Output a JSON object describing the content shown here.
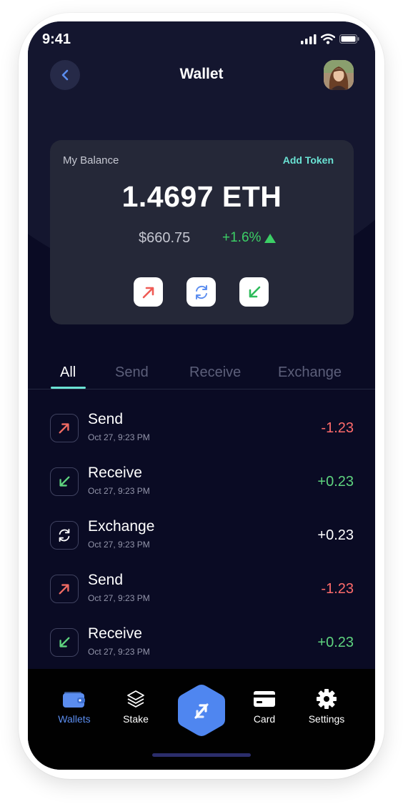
{
  "status_bar": {
    "time": "9:41"
  },
  "header": {
    "title": "Wallet"
  },
  "balance_card": {
    "label": "My Balance",
    "add_token": "Add Token",
    "amount": "1.4697 ETH",
    "usd": "$660.75",
    "change": "+1.6%"
  },
  "tabs": [
    "All",
    "Send",
    "Receive",
    "Exchange"
  ],
  "transactions": [
    {
      "name": "Send",
      "date": "Oct 27,  9:23 PM",
      "amount": "-1.23",
      "icon": "send-icon"
    },
    {
      "name": "Receive",
      "date": "Oct 27,  9:23 PM",
      "amount": "+0.23",
      "icon": "receive-icon"
    },
    {
      "name": "Exchange",
      "date": "Oct 27,  9:23 PM",
      "amount": "+0.23",
      "icon": "exchange-icon"
    },
    {
      "name": "Send",
      "date": "Oct 27,  9:23 PM",
      "amount": "-1.23",
      "icon": "send-icon"
    },
    {
      "name": "Receive",
      "date": "Oct 27,  9:23 PM",
      "amount": "+0.23",
      "icon": "receive-icon"
    }
  ],
  "nav": {
    "wallets": "Wallets",
    "stake": "Stake",
    "card": "Card",
    "settings": "Settings"
  },
  "colors": {
    "background": "#0a0b24",
    "card": "#252838",
    "accent": "#6ae3d4",
    "positive": "#3ccf66",
    "negative": "#ff6b6b",
    "nav_active": "#5b8def"
  }
}
